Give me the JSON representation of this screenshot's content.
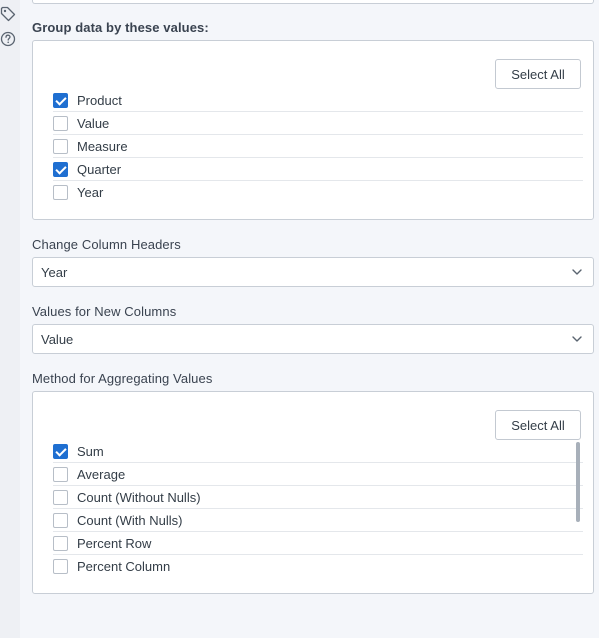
{
  "icons": {
    "tag": "tag-icon",
    "help": "help-circle-icon"
  },
  "group": {
    "label": "Group data by these values:",
    "select_all": "Select All",
    "items": [
      {
        "label": "Product",
        "checked": true
      },
      {
        "label": "Value",
        "checked": false
      },
      {
        "label": "Measure",
        "checked": false
      },
      {
        "label": "Quarter",
        "checked": true
      },
      {
        "label": "Year",
        "checked": false
      }
    ]
  },
  "headers": {
    "label": "Change Column Headers",
    "value": "Year"
  },
  "values": {
    "label": "Values for New Columns",
    "value": "Value"
  },
  "method": {
    "label": "Method for Aggregating Values",
    "select_all": "Select All",
    "items": [
      {
        "label": "Sum",
        "checked": true
      },
      {
        "label": "Average",
        "checked": false
      },
      {
        "label": "Count (Without Nulls)",
        "checked": false
      },
      {
        "label": "Count (With Nulls)",
        "checked": false
      },
      {
        "label": "Percent Row",
        "checked": false
      },
      {
        "label": "Percent Column",
        "checked": false
      }
    ]
  },
  "colors": {
    "accent": "#1f6fd1",
    "border": "#c8ced6",
    "background": "#f4f6fa"
  }
}
